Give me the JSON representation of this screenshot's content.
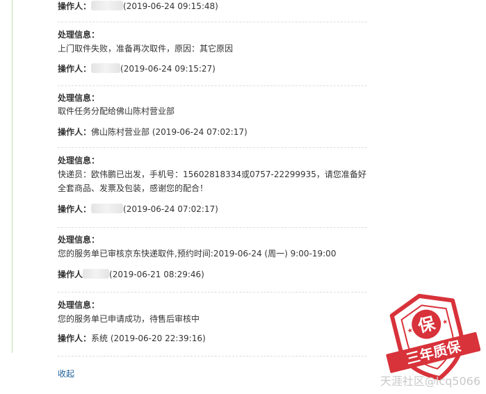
{
  "entries": [
    {
      "label": null,
      "text": null,
      "operator_prefix": "操作人：",
      "operator_name": "",
      "timestamp": "(2019-06-24 09:15:48)",
      "blur_width": 46
    },
    {
      "label": "处理信息：",
      "text": "上门取件失败，准备再次取件，原因：其它原因",
      "operator_prefix": "操作人：",
      "operator_name": "",
      "timestamp": "(2019-06-24 09:15:27)",
      "blur_width": 42
    },
    {
      "label": "处理信息：",
      "text": "取件任务分配给佛山陈村营业部",
      "operator_prefix": "操作人：",
      "operator_name": "佛山陈村营业部",
      "timestamp": "(2019-06-24 07:02:17)",
      "blur_width": 0
    },
    {
      "label": "处理信息：",
      "text": "快递员：欧伟鹏已出发，手机号：15602818334或0757-22299935，请您准备好全套商品、发票及包装，感谢您的配合！",
      "operator_prefix": "操作人：",
      "operator_name": "",
      "timestamp": "(2019-06-24 07:02:17)",
      "blur_width": 46
    },
    {
      "label": "处理信息：",
      "text": "您的服务单已审核京东快递取件,预约时间:2019-06-24 (周一) 9:00-19:00",
      "operator_prefix": "操作人",
      "operator_name": "",
      "timestamp": "(2019-06-21 08:29:46)",
      "blur_width": 38
    },
    {
      "label": "处理信息：",
      "text": "您的服务单已申请成功，待售后审核中",
      "operator_prefix": "操作人：",
      "operator_name": "系统",
      "timestamp": "(2019-06-20 22:39:16)",
      "blur_width": 0
    }
  ],
  "collapse_label": "收起",
  "stamp": {
    "top_char": "保",
    "banner": "三年质保",
    "color": "#d8323a"
  },
  "watermark": "天涯社区@lcq5066"
}
